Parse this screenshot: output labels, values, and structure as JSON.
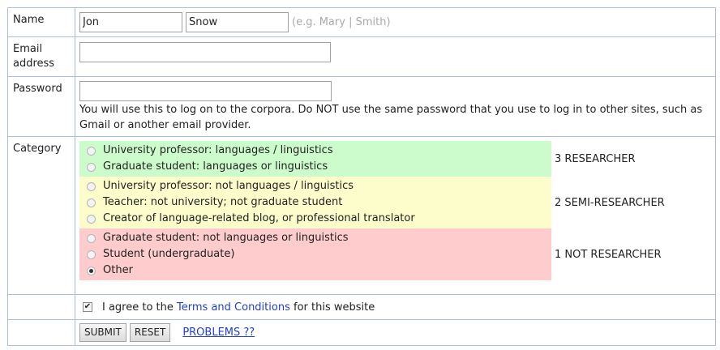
{
  "form": {
    "name": {
      "label": "Name",
      "first_value": "Jon",
      "last_value": "Snow",
      "hint": "(e.g. Mary | Smith)"
    },
    "email": {
      "label": "Email address",
      "value": ""
    },
    "password": {
      "label": "Password",
      "value": "",
      "note": "You will use this to log on to the corpora. Do NOT use the same password that you use to log in to other sites, such as Gmail or another email provider."
    },
    "category": {
      "label": "Category",
      "bands": [
        {
          "color": "#ccfccc",
          "level": "3 RESEARCHER",
          "options": [
            {
              "label": "University professor: languages / linguistics",
              "selected": false
            },
            {
              "label": "Graduate student: languages or linguistics",
              "selected": false
            }
          ]
        },
        {
          "color": "#fdfdcc",
          "level": "2 SEMI-RESEARCHER",
          "options": [
            {
              "label": "University professor: not languages / linguistics",
              "selected": false
            },
            {
              "label": "Teacher: not university; not graduate student",
              "selected": false
            },
            {
              "label": "Creator of language-related blog, or professional translator",
              "selected": false
            }
          ]
        },
        {
          "color": "#fecccc",
          "level": "1 NOT RESEARCHER",
          "options": [
            {
              "label": "Graduate student: not languages or linguistics",
              "selected": false
            },
            {
              "label": "Student (undergraduate)",
              "selected": false
            },
            {
              "label": "Other",
              "selected": true
            }
          ]
        }
      ]
    },
    "agree": {
      "checked": true,
      "prefix": "I agree to the",
      "link": "Terms and Conditions",
      "suffix": "for this website"
    },
    "buttons": {
      "submit": "SUBMIT",
      "reset": "RESET",
      "problems": "PROBLEMS ??"
    }
  },
  "colors": {
    "border": "#a9bde6",
    "link": "#1f3fd0"
  }
}
